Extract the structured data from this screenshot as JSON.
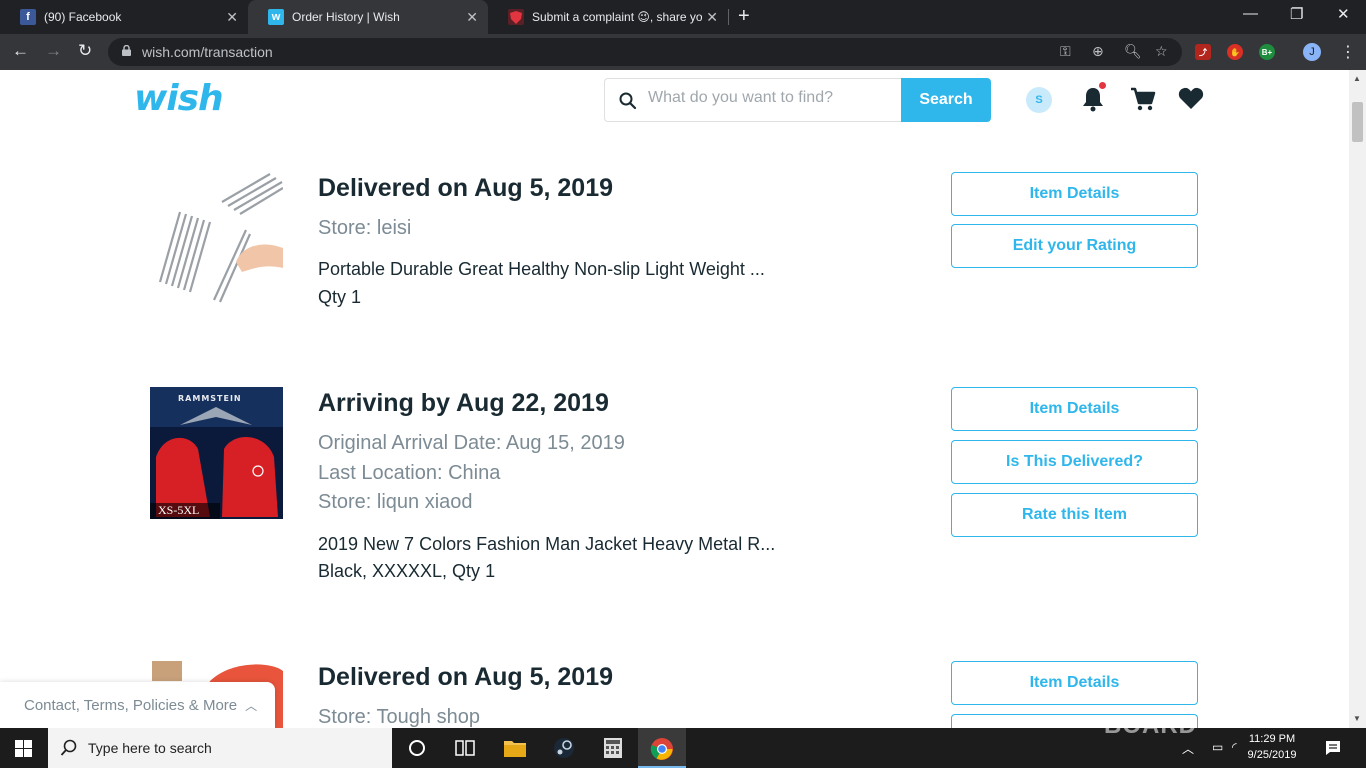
{
  "browser": {
    "tabs": [
      {
        "title": "(90) Facebook"
      },
      {
        "title": "Order History | Wish"
      },
      {
        "title": "Submit a complaint 😉, share yo"
      }
    ],
    "url": "wish.com/transaction",
    "profile_initial": "J",
    "ext_badge": "B+"
  },
  "header": {
    "logo": "wish",
    "search_placeholder": "What do you want to find?",
    "search_button": "Search",
    "avatar_initial": "S"
  },
  "orders": [
    {
      "status": "Delivered on Aug 5, 2019",
      "meta": [
        "Store: leisi"
      ],
      "product": "Portable Durable Great Healthy Non-slip Light Weight ...",
      "detail": "Qty 1",
      "buttons": [
        "Item Details",
        "Edit your Rating"
      ]
    },
    {
      "status": "Arriving by Aug 22, 2019",
      "meta": [
        "Original Arrival Date: Aug 15, 2019",
        "Last Location: China",
        "Store: liqun xiaod"
      ],
      "product": "2019 New 7 Colors Fashion Man Jacket Heavy Metal R...",
      "detail": "Black, XXXXXL, Qty 1",
      "image_caption": "XS-5XL",
      "image_banner": "RAMMSTEIN",
      "buttons": [
        "Item Details",
        "Is This Delivered?",
        "Rate this Item"
      ]
    },
    {
      "status": "Delivered on Aug 5, 2019",
      "meta": [
        "Store: Tough shop"
      ],
      "buttons": [
        "Item Details"
      ]
    }
  ],
  "footer": {
    "label": "Contact, Terms, Policies & More"
  },
  "taskbar": {
    "search_text": "Type here to search",
    "time": "11:29 PM",
    "date": "9/25/2019"
  },
  "watermark": "BOARD",
  "colors": {
    "accent": "#2fb7ec",
    "text": "#192a32",
    "muted": "#7c8b94"
  }
}
